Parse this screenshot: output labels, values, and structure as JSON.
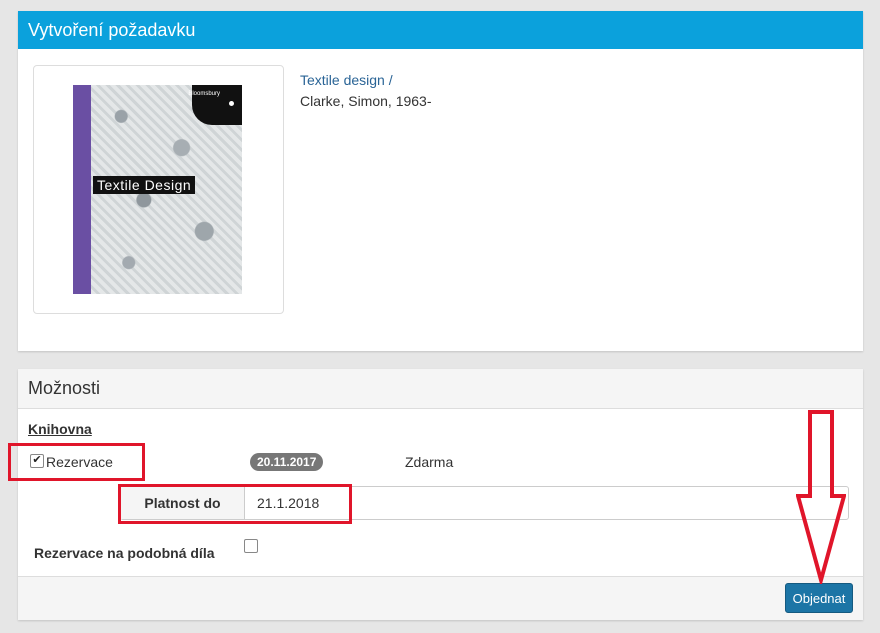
{
  "request_panel": {
    "title": "Vytvoření požadavku",
    "book": {
      "cover_text": "Textile Design",
      "cover_badge": "Bloomsbury",
      "title": "Textile design /",
      "author": "Clarke, Simon, 1963-"
    }
  },
  "options_panel": {
    "title": "Možnosti",
    "library_label": "Knihovna",
    "reservation": {
      "label": "Rezervace",
      "checked": true,
      "date": "20.11.2017",
      "price": "Zdarma"
    },
    "validity": {
      "label": "Platnost do",
      "value": "21.1.2018"
    },
    "similar_works": {
      "label": "Rezervace na podobná díla",
      "checked": false
    },
    "order_button": "Objednat"
  },
  "annotation_color": "#e0152a"
}
